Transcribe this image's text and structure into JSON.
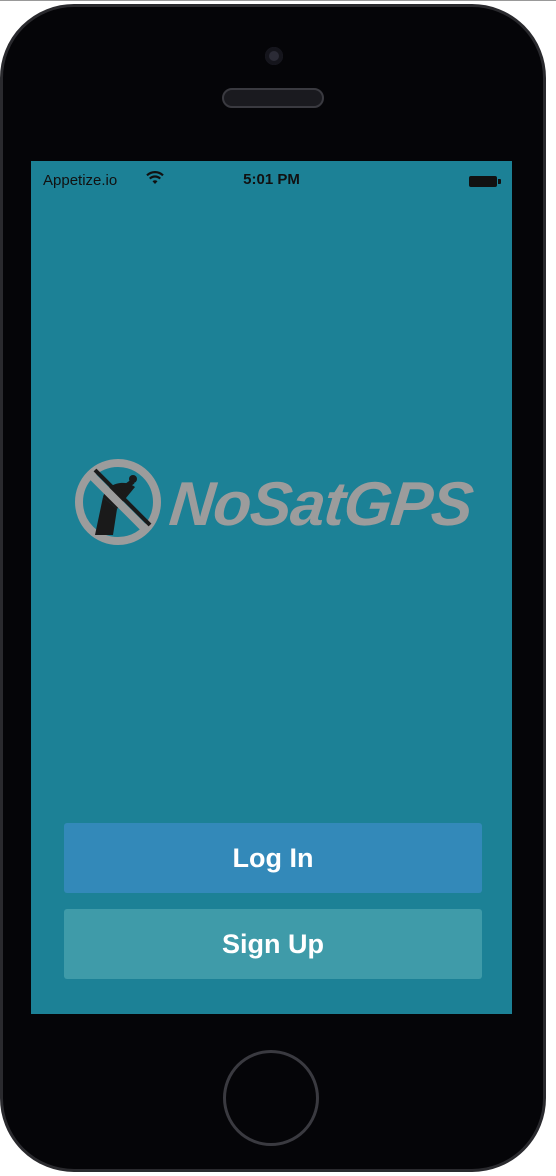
{
  "status_bar": {
    "carrier": "Appetize.io",
    "time": "5:01 PM"
  },
  "logo": {
    "text": "NoSatGPS",
    "icon": "no-satellite-icon"
  },
  "buttons": {
    "login_label": "Log In",
    "signup_label": "Sign Up"
  },
  "colors": {
    "screen_background": "#1c8196",
    "login_button": "#3389b9",
    "signup_button": "#3f9ba9",
    "logo_gray": "#9c9c9c"
  }
}
